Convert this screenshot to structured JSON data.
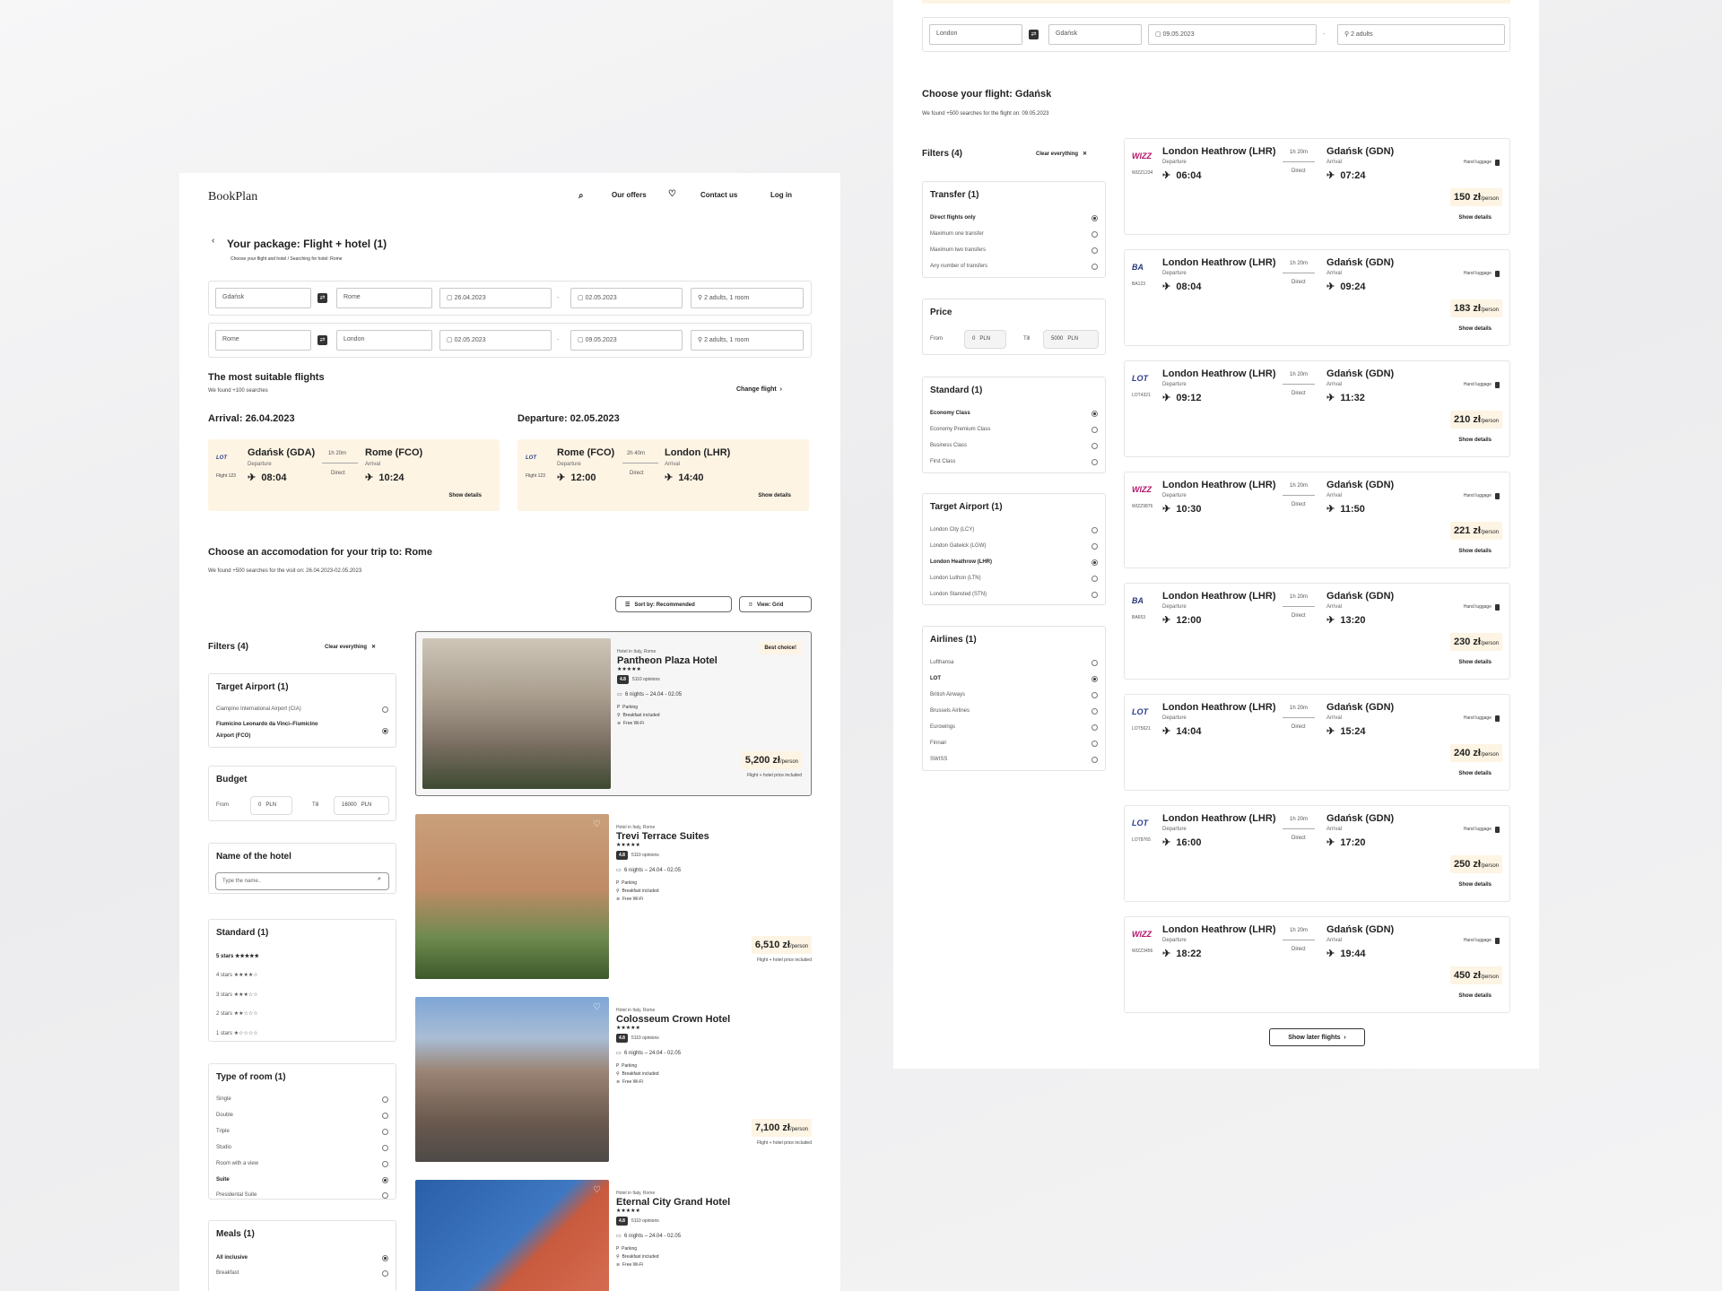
{
  "left": {
    "logo": "BookPlan",
    "nav": {
      "offers": "Our offers",
      "contact": "Contact us",
      "login": "Log in"
    },
    "package_title": "Your package: Flight + hotel (1)",
    "breadcrumb": "Choose your flight and hotel  /  Searching for hotel: Rome",
    "search_rows": [
      {
        "from": "Gdańsk",
        "to": "Rome",
        "date1": "26.04.2023",
        "date2": "02.05.2023",
        "guests": "2 adults, 1 room"
      },
      {
        "from": "Rome",
        "to": "London",
        "date1": "02.05.2023",
        "date2": "09.05.2023",
        "guests": "2 adults, 1 room"
      }
    ],
    "flights_title": "The most suitable flights",
    "flights_sub": "We found +100 searches",
    "change_flight": "Change flight",
    "arrival_title": "Arrival: 26.04.2023",
    "departure_title": "Departure: 02.05.2023",
    "flight_cards": [
      {
        "airline": "LOT",
        "flight": "Flight 123",
        "from": "Gdańsk (GDA)",
        "dep_label": "Departure",
        "dep_time": "08:04",
        "duration": "1h 20m",
        "direct": "Direct",
        "to": "Rome (FCO)",
        "arr_label": "Arrival",
        "arr_time": "10:24",
        "details": "Show details"
      },
      {
        "airline": "LOT",
        "flight": "Flight 123",
        "from": "Rome (FCO)",
        "dep_label": "Departure",
        "dep_time": "12:00",
        "duration": "2h 40m",
        "direct": "Direct",
        "to": "London (LHR)",
        "arr_label": "Arrival",
        "arr_time": "14:40",
        "details": "Show details"
      }
    ],
    "acc_title": "Choose an accomodation for your trip to: Rome",
    "acc_sub": "We found +500 searches for the visit on: 26.04.2023-02.05.2023",
    "sort_label": "Sort by: Recommended",
    "view_label": "View: Grid",
    "filters_title": "Filters (4)",
    "clear": "Clear everything",
    "target_airport": {
      "title": "Target Airport (1)",
      "options": [
        {
          "label": "Ciampino International Airport (CIA)",
          "on": false
        },
        {
          "label": "Fiumicino Leonardo da Vinci–Fiumicino Airport (FCO)",
          "on": true
        }
      ]
    },
    "budget": {
      "title": "Budget",
      "from": "From",
      "from_val": "0",
      "till": "Till",
      "till_val": "16000",
      "cur": "PLN"
    },
    "hotel_name": {
      "title": "Name of the hotel",
      "placeholder": "Type the name.."
    },
    "standard": {
      "title": "Standard (1)",
      "options": [
        {
          "label": "5 stars",
          "stars": "★★★★★",
          "on": true
        },
        {
          "label": "4 stars",
          "stars": "★★★★☆",
          "on": false
        },
        {
          "label": "3 stars",
          "stars": "★★★☆☆",
          "on": false
        },
        {
          "label": "2 stars",
          "stars": "★★☆☆☆",
          "on": false
        },
        {
          "label": "1 stars",
          "stars": "★☆☆☆☆",
          "on": false
        }
      ]
    },
    "room": {
      "title": "Type of room (1)",
      "options": [
        {
          "label": "Single",
          "on": false
        },
        {
          "label": "Double",
          "on": false
        },
        {
          "label": "Triple",
          "on": false
        },
        {
          "label": "Studio",
          "on": false
        },
        {
          "label": "Room with a view",
          "on": false
        },
        {
          "label": "Suite",
          "on": true
        },
        {
          "label": "Presidental Suite",
          "on": false
        }
      ]
    },
    "meals": {
      "title": "Meals (1)",
      "options": [
        {
          "label": "All inclusive",
          "on": true
        },
        {
          "label": "Breakfast",
          "on": false
        }
      ]
    },
    "hotels": [
      {
        "loc": "Hotel in Italy, Rome",
        "name": "Pantheon Plaza Hotel",
        "stars": "★★★★★",
        "rating": "4.8",
        "opinions": "5110 opinions",
        "nights": "6 nights – 24.04 - 02.05",
        "amenities": [
          "Parking",
          "Breakfast included",
          "Free Wi-Fi"
        ],
        "price": "5,200 zł",
        "unit": "/person",
        "note": "Flight + hotel price included",
        "badge": "Best choice!"
      },
      {
        "loc": "Hotel in Italy, Rome",
        "name": "Trevi Terrace Suites",
        "stars": "★★★★★",
        "rating": "4.8",
        "opinions": "5110 opinions",
        "nights": "6 nights – 24.04 - 02.05",
        "amenities": [
          "Parking",
          "Breakfast included",
          "Free Wi-Fi"
        ],
        "price": "6,510 zł",
        "unit": "/person",
        "note": "Flight + hotel price included"
      },
      {
        "loc": "Hotel in Italy, Rome",
        "name": "Colosseum Crown Hotel",
        "stars": "★★★★★",
        "rating": "4.8",
        "opinions": "5110 opinions",
        "nights": "6 nights – 24.04 - 02.05",
        "amenities": [
          "Parking",
          "Breakfast included",
          "Free Wi-Fi"
        ],
        "price": "7,100 zł",
        "unit": "/person",
        "note": "Flight + hotel price included"
      },
      {
        "loc": "Hotel in Italy, Rome",
        "name": "Eternal City Grand Hotel",
        "stars": "★★★★★",
        "rating": "4.8",
        "opinions": "5110 opinions",
        "nights": "6 nights – 24.04 - 02.05",
        "amenities": [
          "Parking",
          "Breakfast included",
          "Free Wi-Fi"
        ]
      }
    ]
  },
  "right": {
    "search": {
      "from": "London",
      "to": "Gdańsk",
      "date": "09.05.2023",
      "guests": "2 adults"
    },
    "title": "Choose your flight: Gdańsk",
    "sub": "We found +500 searches for the flight on: 09.05.2023",
    "filters_title": "Filters (4)",
    "clear": "Clear everything",
    "transfer": {
      "title": "Transfer (1)",
      "options": [
        {
          "label": "Direct flights only",
          "on": true
        },
        {
          "label": "Maximum one transfer",
          "on": false
        },
        {
          "label": "Maximum two transfers",
          "on": false
        },
        {
          "label": "Any number of transfers",
          "on": false
        }
      ]
    },
    "price": {
      "title": "Price",
      "from": "From",
      "from_val": "0",
      "till": "Till",
      "till_val": "5000",
      "cur": "PLN"
    },
    "standard": {
      "title": "Standard (1)",
      "options": [
        {
          "label": "Economy Class",
          "on": true
        },
        {
          "label": "Economy Premium Class",
          "on": false
        },
        {
          "label": "Business Class",
          "on": false
        },
        {
          "label": "First Class",
          "on": false
        }
      ]
    },
    "airport": {
      "title": "Target Airport (1)",
      "options": [
        {
          "label": "London City (LCY)",
          "on": false
        },
        {
          "label": "London Gatwick (LGW)",
          "on": false
        },
        {
          "label": "London Heathrow (LHR)",
          "on": true
        },
        {
          "label": "London Luthon (LTN)",
          "on": false
        },
        {
          "label": "London Stansted (STN)",
          "on": false
        }
      ]
    },
    "airlines": {
      "title": "Airlines (1)",
      "options": [
        {
          "label": "Lufthansa",
          "on": false
        },
        {
          "label": "LOT",
          "on": true
        },
        {
          "label": "British Airways",
          "on": false
        },
        {
          "label": "Brussels Airlines",
          "on": false
        },
        {
          "label": "Eurowings",
          "on": false
        },
        {
          "label": "Finnair",
          "on": false
        },
        {
          "label": "SWISS",
          "on": false
        }
      ]
    },
    "flights": [
      {
        "logo": "WIZZ",
        "logo_color": "#b5156a",
        "code": "WIZZ1234",
        "dep": "06:04",
        "arr": "07:24",
        "price": "150 zł"
      },
      {
        "logo": "BA",
        "logo_color": "#2a3a7a",
        "code": "BA123",
        "dep": "08:04",
        "arr": "09:24",
        "price": "183 zł"
      },
      {
        "logo": "LOT",
        "logo_color": "#2c3d8f",
        "code": "LOT4321",
        "dep": "09:12",
        "arr": "11:32",
        "price": "210 zł"
      },
      {
        "logo": "WIZZ",
        "logo_color": "#b5156a",
        "code": "WIZZ9876",
        "dep": "10:30",
        "arr": "11:50",
        "price": "221 zł"
      },
      {
        "logo": "BA",
        "logo_color": "#2a3a7a",
        "code": "BA653",
        "dep": "12:00",
        "arr": "13:20",
        "price": "230 zł"
      },
      {
        "logo": "LOT",
        "logo_color": "#2c3d8f",
        "code": "LOT5621",
        "dep": "14:04",
        "arr": "15:24",
        "price": "240 zł"
      },
      {
        "logo": "LOT",
        "logo_color": "#2c3d8f",
        "code": "LOT8765",
        "dep": "16:00",
        "arr": "17:20",
        "price": "250 zł"
      },
      {
        "logo": "WIZZ",
        "logo_color": "#b5156a",
        "code": "WIZZ3456",
        "dep": "18:22",
        "arr": "19:44",
        "price": "450 zł"
      }
    ],
    "flight_common": {
      "from": "London Heathrow (LHR)",
      "to": "Gdańsk (GDN)",
      "dep_label": "Departure",
      "arr_label": "Arrival",
      "duration": "1h 20m",
      "direct": "Direct",
      "luggage": "Hand luggage",
      "unit": "/person",
      "details": "Show details"
    },
    "later": "Show later flights"
  }
}
